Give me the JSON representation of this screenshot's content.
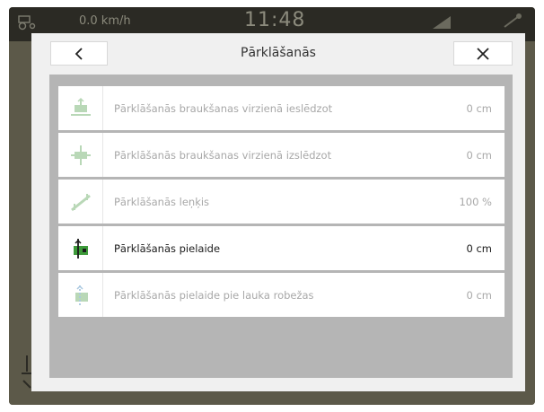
{
  "statusbar": {
    "speed": "0.0 km/h",
    "clock": "11:48"
  },
  "dialog": {
    "title": "Pārklāšanās",
    "back_icon": "chevron-left-icon",
    "close_icon": "close-icon"
  },
  "rows": [
    {
      "label": "Pārklāšanās braukšanas virzienā ieslēdzot",
      "value": "0 cm",
      "icon": "overlap-on-icon",
      "enabled": false
    },
    {
      "label": "Pārklāšanās braukšanas virzienā izslēdzot",
      "value": "0 cm",
      "icon": "overlap-off-icon",
      "enabled": false
    },
    {
      "label": "Pārklāšanās leņķis",
      "value": "100 %",
      "icon": "overlap-angle-icon",
      "enabled": false
    },
    {
      "label": "Pārklāšanās pielaide",
      "value": "0 cm",
      "icon": "overlap-tolerance-icon",
      "enabled": true
    },
    {
      "label": "Pārklāšanās pielaide pie lauka robežas",
      "value": "0 cm",
      "icon": "overlap-field-boundary-icon",
      "enabled": false
    }
  ],
  "colors": {
    "accent_green": "#3d9a3a",
    "disabled_text": "#a8a8a8"
  }
}
